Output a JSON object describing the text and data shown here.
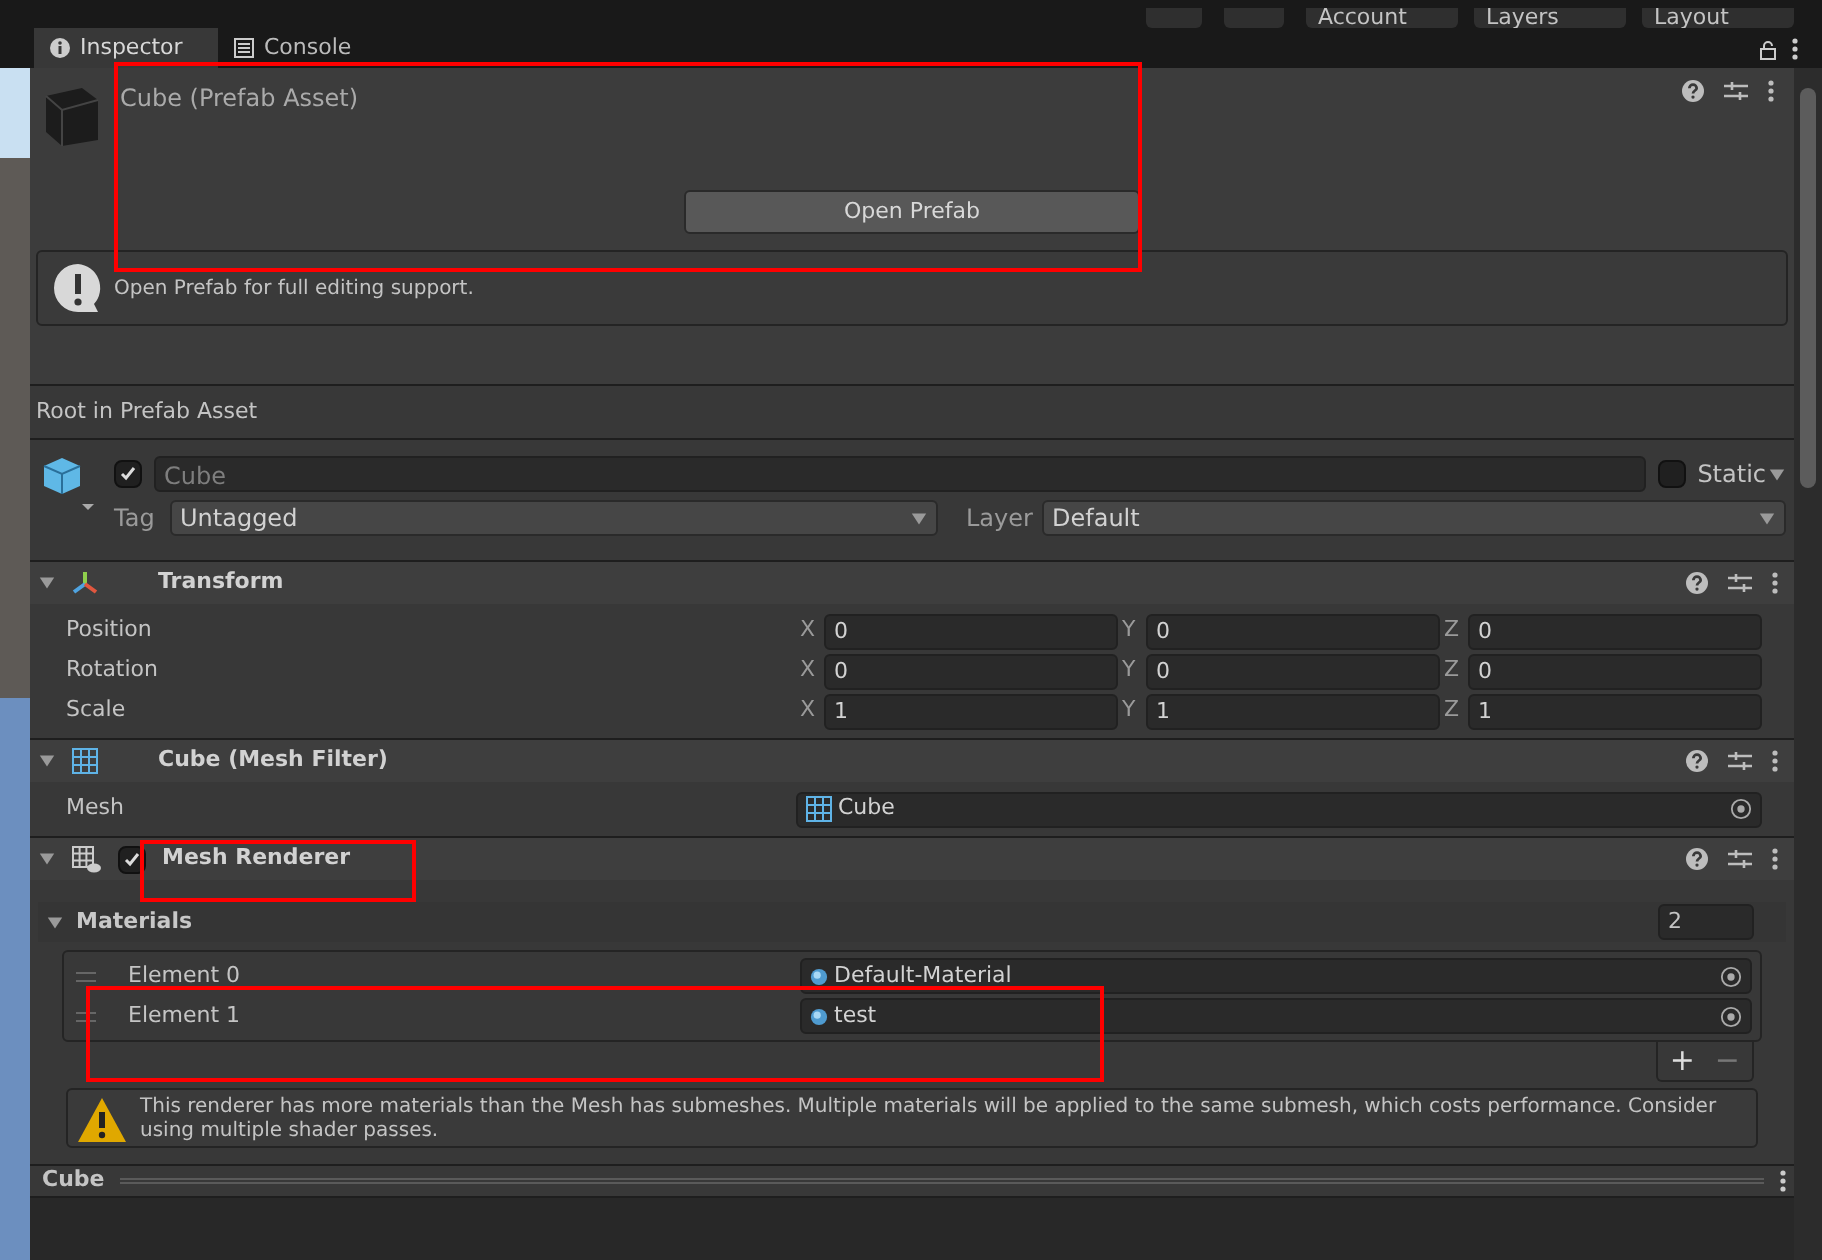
{
  "toolbar": {
    "buttons": [
      "Account",
      "Layers",
      "Layout"
    ]
  },
  "tabs": [
    {
      "label": "Inspector",
      "selected": true
    },
    {
      "label": "Console",
      "selected": false
    }
  ],
  "prefab_header": {
    "title": "Cube (Prefab Asset)",
    "button": "Open Prefab",
    "help": "Open Prefab for full editing support."
  },
  "section_label": "Root in Prefab Asset",
  "game_object": {
    "active": true,
    "name": "Cube",
    "static": false,
    "static_label": "Static",
    "tag_label": "Tag",
    "tag": "Untagged",
    "layer_label": "Layer",
    "layer": "Default"
  },
  "components": [
    {
      "kind": "transform",
      "title": "Transform",
      "rows": [
        {
          "label": "Position",
          "fields": [
            {
              "axis": "X",
              "value": "0"
            },
            {
              "axis": "Y",
              "value": "0"
            },
            {
              "axis": "Z",
              "value": "0"
            }
          ]
        },
        {
          "label": "Rotation",
          "fields": [
            {
              "axis": "X",
              "value": "0"
            },
            {
              "axis": "Y",
              "value": "0"
            },
            {
              "axis": "Z",
              "value": "0"
            }
          ]
        },
        {
          "label": "Scale",
          "fields": [
            {
              "axis": "X",
              "value": "1"
            },
            {
              "axis": "Y",
              "value": "1"
            },
            {
              "axis": "Z",
              "value": "1"
            }
          ]
        }
      ]
    },
    {
      "kind": "mesh_filter",
      "title": "Cube (Mesh Filter)",
      "field_label": "Mesh",
      "field_value": "Cube"
    },
    {
      "kind": "mesh_renderer",
      "title": "Mesh Renderer",
      "enabled": true,
      "materials_label": "Materials",
      "expanded": true,
      "count": "2",
      "elements": [
        {
          "label": "Element 0",
          "value": "Default-Material"
        },
        {
          "label": "Element 1",
          "value": "test"
        }
      ],
      "add": "+",
      "remove": "−",
      "warning": "This renderer has more materials than the Mesh has submeshes. Multiple materials will be applied to the same submesh, which costs performance. Consider using multiple shader passes."
    }
  ],
  "footer": {
    "title": "Cube"
  }
}
